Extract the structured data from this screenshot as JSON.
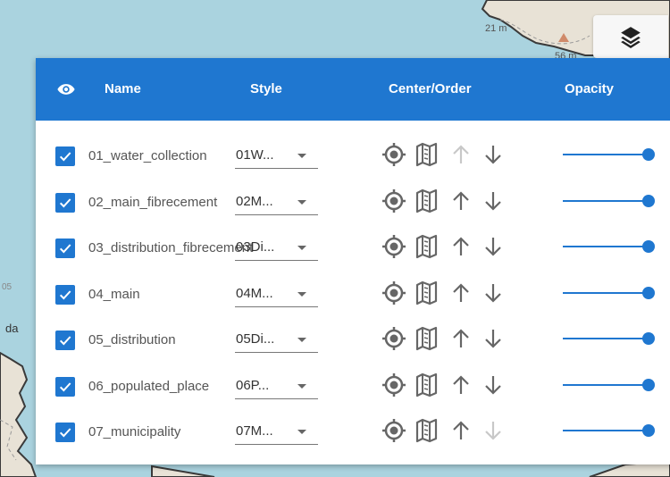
{
  "map": {
    "labels": [
      "21 m",
      "56 m",
      "da",
      "05"
    ]
  },
  "header": {
    "name": "Name",
    "style": "Style",
    "center_order": "Center/Order",
    "opacity": "Opacity"
  },
  "colors": {
    "primary": "#1f77d0",
    "disabled_arrow": "#c8c8c8",
    "icon": "#666666"
  },
  "layers": [
    {
      "name": "01_water_collection",
      "style": "01W...",
      "checked": true,
      "up_enabled": false,
      "down_enabled": true,
      "opacity": 1.0
    },
    {
      "name": "02_main_fibrecement",
      "style": "02M...",
      "checked": true,
      "up_enabled": true,
      "down_enabled": true,
      "opacity": 1.0
    },
    {
      "name": "03_distribution_fibrecement",
      "style": "03Di...",
      "checked": true,
      "up_enabled": true,
      "down_enabled": true,
      "opacity": 1.0
    },
    {
      "name": "04_main",
      "style": "04M...",
      "checked": true,
      "up_enabled": true,
      "down_enabled": true,
      "opacity": 1.0
    },
    {
      "name": "05_distribution",
      "style": "05Di...",
      "checked": true,
      "up_enabled": true,
      "down_enabled": true,
      "opacity": 1.0
    },
    {
      "name": "06_populated_place",
      "style": "06P...",
      "checked": true,
      "up_enabled": true,
      "down_enabled": true,
      "opacity": 1.0
    },
    {
      "name": "07_municipality",
      "style": "07M...",
      "checked": true,
      "up_enabled": true,
      "down_enabled": false,
      "opacity": 1.0
    }
  ],
  "icons": {
    "header_eye": "eye-icon",
    "layers_button": "layers-icon",
    "center": "crosshair-icon",
    "zoom_extent": "map-icon",
    "up": "arrow-up-icon",
    "down": "arrow-down-icon",
    "dropdown": "caret-down-icon",
    "checkbox": "checkbox-checked-icon"
  }
}
